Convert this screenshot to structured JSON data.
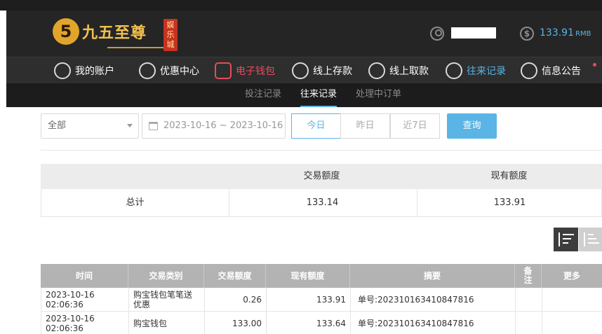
{
  "header": {
    "logo_mark": "5",
    "logo_text": "九五至尊",
    "logo_tag": "娱乐城",
    "balance": "133.91",
    "balance_unit": "RMB"
  },
  "nav": {
    "items": [
      {
        "label": "我的账户",
        "icon": "user-icon"
      },
      {
        "label": "优惠中心",
        "icon": "gift-icon"
      },
      {
        "label": "电子钱包",
        "icon": "wallet-icon"
      },
      {
        "label": "线上存款",
        "icon": "deposit-icon"
      },
      {
        "label": "线上取款",
        "icon": "withdraw-icon"
      },
      {
        "label": "往来记录",
        "icon": "records-icon"
      },
      {
        "label": "信息公告",
        "icon": "bell-icon"
      }
    ]
  },
  "subtabs": [
    "投注记录",
    "往来记录",
    "处理中订单"
  ],
  "filter": {
    "type_select": "全部",
    "date_range": "2023-10-16 ~ 2023-10-16",
    "quick_ranges": [
      "今日",
      "昨日",
      "近7日"
    ],
    "query_label": "查询"
  },
  "summary": {
    "headers": [
      "交易额度",
      "现有额度"
    ],
    "row_label": "总计",
    "amount": "133.14",
    "balance": "133.91"
  },
  "table": {
    "headers": [
      "时间",
      "交易类别",
      "交易额度",
      "现有额度",
      "摘要",
      "备注",
      "更多"
    ],
    "rows": [
      {
        "time": "2023-10-16 02:06:36",
        "type": "购宝钱包笔笔送优惠",
        "amount": "0.26",
        "balance": "133.91",
        "summary": "单号:202310163410847816",
        "remark": "",
        "more": ""
      },
      {
        "time": "2023-10-16 02:06:36",
        "type": "购宝钱包",
        "amount": "133.00",
        "balance": "133.64",
        "summary": "单号:202310163410847816",
        "remark": "",
        "more": ""
      }
    ]
  }
}
